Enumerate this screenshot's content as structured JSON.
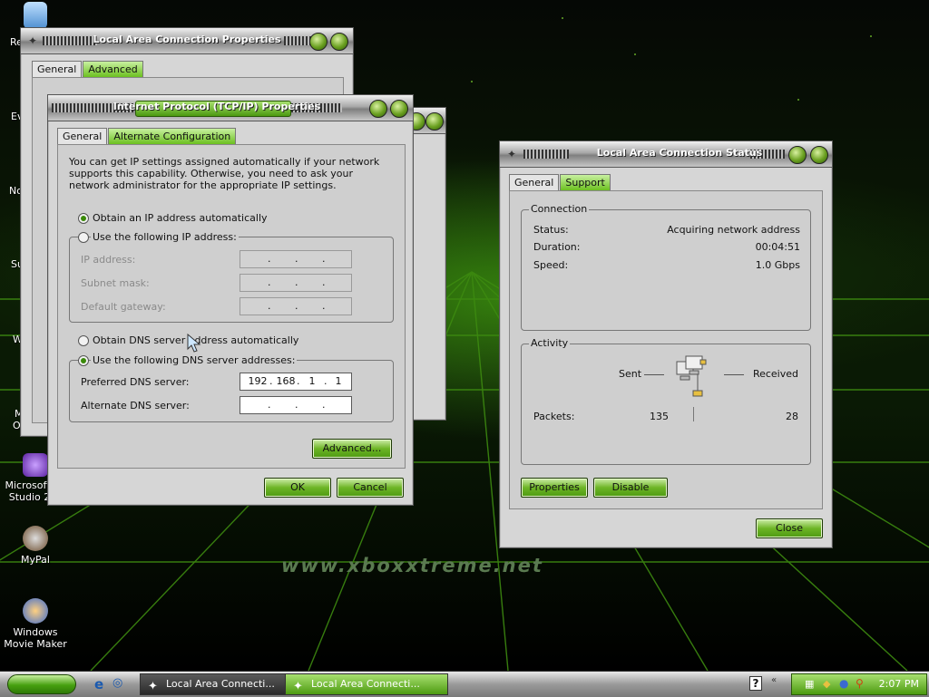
{
  "desktop": {
    "watermark": "www.xboxxtreme.net",
    "edge_labels": [
      "Re",
      "Ev",
      "No",
      "Su",
      "W",
      "M",
      "O"
    ],
    "icons": [
      {
        "label": "Microsoft V Studio 20",
        "icon": "visual-studio-icon"
      },
      {
        "label": "MyPal",
        "icon": "mypal-icon"
      },
      {
        "label": "Windows Movie Maker",
        "icon": "movie-maker-icon"
      }
    ]
  },
  "lac_properties": {
    "title": "Local Area Connection Properties",
    "tabs": [
      "General",
      "Advanced"
    ]
  },
  "tcpip": {
    "title": "Internet Protocol (TCP/IP) Properties",
    "tabs": [
      "General",
      "Alternate Configuration"
    ],
    "intro": "You can get IP settings assigned automatically if your network supports this capability. Otherwise, you need to ask your network administrator for the appropriate IP settings.",
    "opt_auto_ip": "Obtain an IP address automatically",
    "opt_manual_ip": "Use the following IP address:",
    "ip_address_label": "IP address:",
    "subnet_label": "Subnet mask:",
    "gateway_label": "Default gateway:",
    "opt_auto_dns": "Obtain DNS server address automatically",
    "opt_manual_dns": "Use the following DNS server addresses:",
    "preferred_dns_label": "Preferred DNS server:",
    "preferred_dns": [
      "192",
      "168",
      "1",
      "1"
    ],
    "alternate_dns_label": "Alternate DNS server:",
    "advanced_button": "Advanced...",
    "ok_button": "OK",
    "cancel_button": "Cancel"
  },
  "status": {
    "title": "Local Area Connection Status",
    "tabs": [
      "General",
      "Support"
    ],
    "connection_group": "Connection",
    "status_label": "Status:",
    "status_value": "Acquiring network address",
    "duration_label": "Duration:",
    "duration_value": "00:04:51",
    "speed_label": "Speed:",
    "speed_value": "1.0 Gbps",
    "activity_group": "Activity",
    "sent_label": "Sent",
    "received_label": "Received",
    "packets_label": "Packets:",
    "packets_sent": "135",
    "packets_received": "28",
    "properties_button": "Properties",
    "disable_button": "Disable",
    "close_button": "Close"
  },
  "taskbar": {
    "tasks": [
      "Local Area Connecti...",
      "Local Area Connecti..."
    ],
    "clock": "2:07 PM"
  },
  "colors": {
    "accent": "#6db526",
    "titlebar": "#a8a8a8",
    "desktop_glow": "#50be14"
  }
}
